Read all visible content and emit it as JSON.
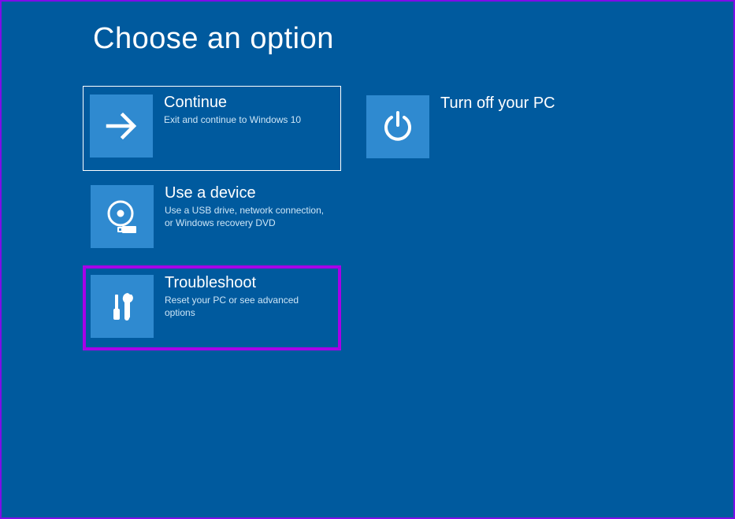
{
  "page": {
    "title": "Choose an option"
  },
  "options": {
    "continue": {
      "title": "Continue",
      "desc": "Exit and continue to Windows 10"
    },
    "useDevice": {
      "title": "Use a device",
      "desc": "Use a USB drive, network connection, or Windows recovery DVD"
    },
    "troubleshoot": {
      "title": "Troubleshoot",
      "desc": "Reset your PC or see advanced options"
    },
    "turnOff": {
      "title": "Turn off your PC"
    }
  }
}
